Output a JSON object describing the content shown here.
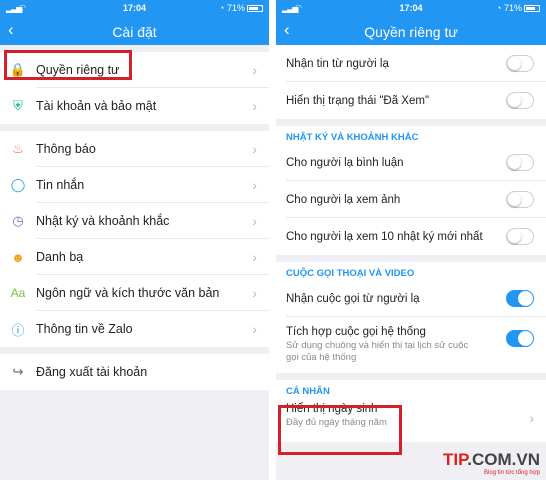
{
  "left": {
    "status": {
      "time": "17:04",
      "battery": "71%"
    },
    "title": "Cài đặt",
    "items": [
      {
        "label": "Quyền riêng tư"
      },
      {
        "label": "Tài khoản và bảo mật"
      },
      {
        "label": "Thông báo"
      },
      {
        "label": "Tin nhắn"
      },
      {
        "label": "Nhật ký và khoảnh khắc"
      },
      {
        "label": "Danh bạ"
      },
      {
        "label": "Ngôn ngữ và kích thước văn bản"
      },
      {
        "label": "Thông tin về Zalo"
      },
      {
        "label": "Đăng xuất tài khoản"
      }
    ]
  },
  "right": {
    "status": {
      "time": "17:04",
      "battery": "71%"
    },
    "title": "Quyền riêng tư",
    "rows_top": [
      {
        "label": "Nhận tin từ người lạ",
        "state": "off"
      },
      {
        "label": "Hiển thị trạng thái \"Đã Xem\"",
        "state": "off"
      }
    ],
    "section_diary": "NHẬT KÝ VÀ KHOẢNH KHẮC",
    "rows_diary": [
      {
        "label": "Cho người lạ bình luận",
        "state": "off"
      },
      {
        "label": "Cho người lạ xem ảnh",
        "state": "off"
      },
      {
        "label": "Cho người lạ xem 10 nhật ký mới nhất",
        "state": "off"
      }
    ],
    "section_call": "CUỘC GỌI THOẠI VÀ VIDEO",
    "rows_call": [
      {
        "label": "Nhận cuộc gọi từ người lạ",
        "state": "on"
      },
      {
        "label": "Tích hợp cuộc gọi hệ thống",
        "sub": "Sử dụng chuông và hiển thị tại lịch sử cuộc gọi của hệ thống",
        "state": "on"
      }
    ],
    "section_personal": "CÁ NHÂN",
    "birthday": {
      "label": "Hiển thị ngày sinh",
      "sub": "Đầy đủ ngày tháng năm"
    }
  },
  "watermark": {
    "tip": "TIP",
    "com": ".COM.VN",
    "tagline": "Blog tin tức tổng hợp"
  },
  "colors": {
    "accent": "#2196f3",
    "highlight": "#d3202a"
  }
}
